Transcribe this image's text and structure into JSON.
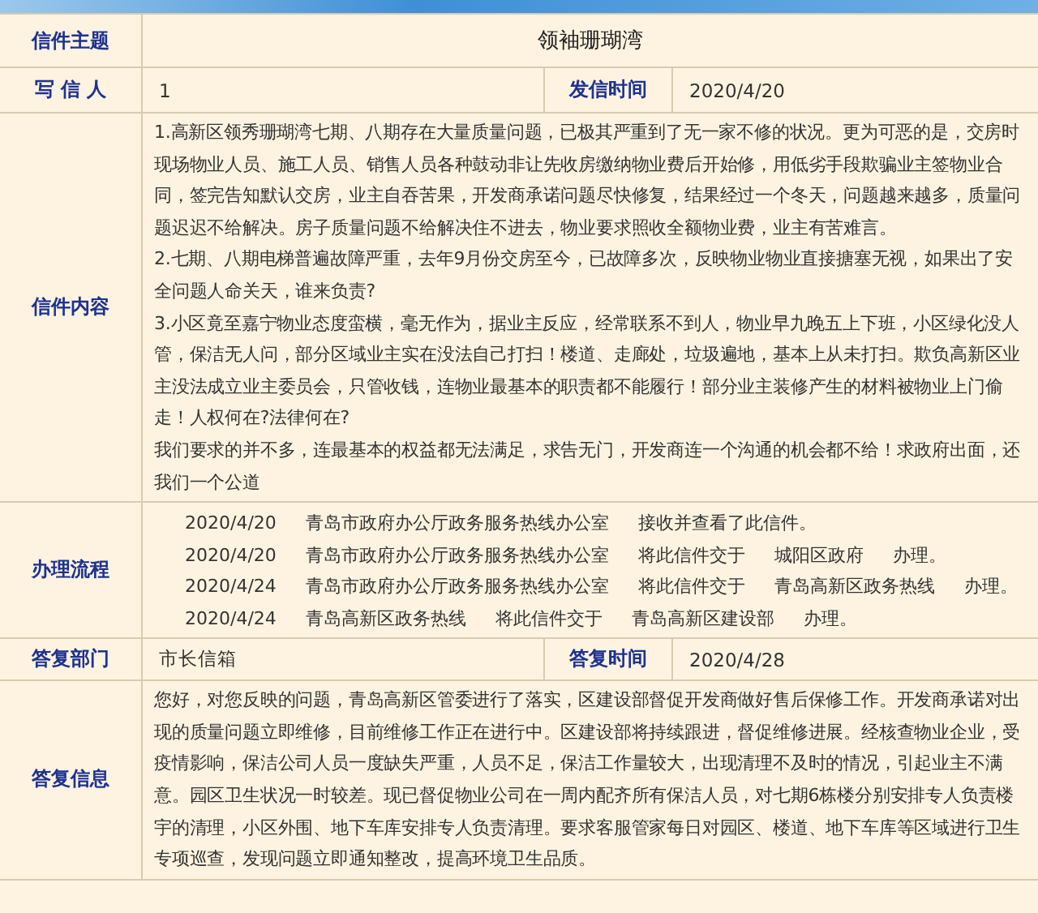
{
  "subject": {
    "label": "信件主题",
    "value": "领袖珊瑚湾"
  },
  "writer": {
    "label": "写 信 人",
    "value": "1",
    "time_label": "发信时间",
    "time": "2020/4/20"
  },
  "content": {
    "label": "信件内容",
    "paragraphs": [
      "1.高新区领秀珊瑚湾七期、八期存在大量质量问题，已极其严重到了无一家不修的状况。更为可恶的是，交房时现场物业人员、施工人员、销售人员各种鼓动非让先收房缴纳物业费后开始修，用低劣手段欺骗业主签物业合同，签完告知默认交房，业主自吞苦果，开发商承诺问题尽快修复，结果经过一个冬天，问题越来越多，质量问题迟迟不给解决。房子质量问题不给解决住不进去，物业要求照收全额物业费，业主有苦难言。",
      "2.七期、八期电梯普遍故障严重，去年9月份交房至今，已故障多次，反映物业物业直接搪塞无视，如果出了安全问题人命关天，谁来负责?",
      "3.小区竟至嘉宁物业态度蛮横，毫无作为，据业主反应，经常联系不到人，物业早九晚五上下班，小区绿化没人管，保洁无人问，部分区域业主实在没法自己打扫！楼道、走廊处，垃圾遍地，基本上从未打扫。欺负高新区业主没法成立业主委员会，只管收钱，连物业最基本的职责都不能履行！部分业主装修产生的材料被物业上门偷走！人权何在?法律何在?",
      "我们要求的并不多，连最基本的权益都无法满足，求告无门，开发商连一个沟通的机会都不给！求政府出面，还我们一个公道"
    ]
  },
  "process": {
    "label": "办理流程",
    "steps": [
      {
        "cells": [
          "2020/4/20",
          "青岛市政府办公厅政务服务热线办公室",
          "接收并查看了此信件。"
        ]
      },
      {
        "cells": [
          "2020/4/20",
          "青岛市政府办公厅政务服务热线办公室",
          "将此信件交于",
          "城阳区政府",
          "办理。"
        ]
      },
      {
        "cells": [
          "2020/4/24",
          "青岛市政府办公厅政务服务热线办公室",
          "将此信件交于",
          "青岛高新区政务热线",
          "办理。"
        ]
      },
      {
        "cells": [
          "2020/4/24",
          "青岛高新区政务热线",
          "将此信件交于",
          "青岛高新区建设部",
          "办理。"
        ]
      }
    ]
  },
  "reply_dept": {
    "label": "答复部门",
    "value": "市长信箱",
    "time_label": "答复时间",
    "time": "2020/4/28"
  },
  "reply": {
    "label": "答复信息",
    "text": "您好，对您反映的问题，青岛高新区管委进行了落实，区建设部督促开发商做好售后保修工作。开发商承诺对出现的质量问题立即维修，目前维修工作正在进行中。区建设部将持续跟进，督促维修进展。经核查物业企业，受疫情影响，保洁公司人员一度缺失严重，人员不足，保洁工作量较大，出现清理不及时的情况，引起业主不满意。园区卫生状况一时较差。现已督促物业公司在一周内配齐所有保洁人员，对七期6栋楼分别安排专人负责楼宇的清理，小区外围、地下车库安排专人负责清理。要求客服管家每日对园区、楼道、地下车库等区域进行卫生专项巡查，发现问题立即通知整改，提高环境卫生品质。"
  }
}
